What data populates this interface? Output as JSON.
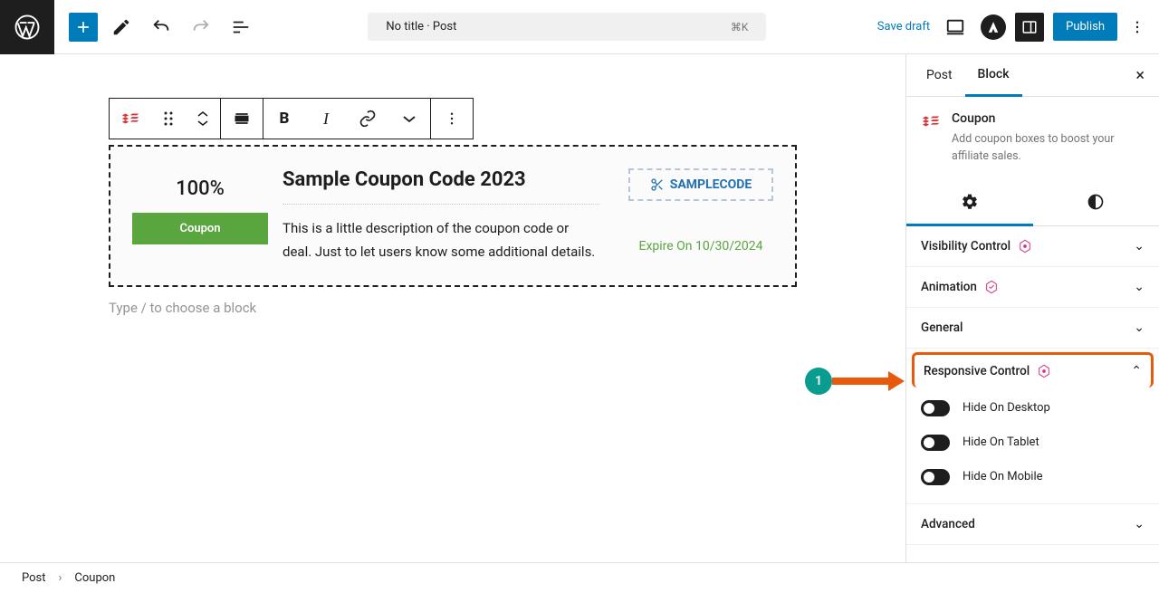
{
  "topbar": {
    "title": "No title · Post",
    "shortcut": "⌘K",
    "save_draft": "Save draft",
    "publish": "Publish"
  },
  "block_toolbar": {
    "bold": "B",
    "italic": "I"
  },
  "coupon": {
    "percent": "100%",
    "badge": "Coupon",
    "title": "Sample Coupon Code 2023",
    "description": "This is a little description of the coupon code or deal. Just to let users know some additional details.",
    "code": "SAMPLECODE",
    "expire": "Expire On 10/30/2024"
  },
  "placeholder": "Type / to choose a block",
  "sidebar": {
    "tabs": {
      "post": "Post",
      "block": "Block"
    },
    "block_name": "Coupon",
    "block_desc": "Add coupon boxes to boost your affiliate sales.",
    "panels": {
      "visibility": "Visibility Control",
      "animation": "Animation",
      "general": "General",
      "responsive": "Responsive Control",
      "advanced": "Advanced"
    },
    "responsive": {
      "hide_desktop": "Hide On Desktop",
      "hide_tablet": "Hide On Tablet",
      "hide_mobile": "Hide On Mobile"
    }
  },
  "annotation": {
    "number": "1"
  },
  "breadcrumb": {
    "post": "Post",
    "block": "Coupon"
  }
}
